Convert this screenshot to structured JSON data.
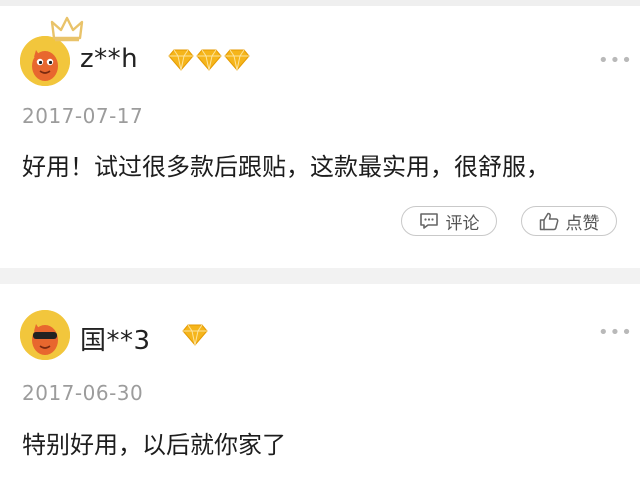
{
  "comments": [
    {
      "username": "z**h",
      "date": "2017-07-17",
      "text": "好用！试过很多款后跟贴，这款最实用，很舒服，",
      "diamond_count": 3,
      "more_label": "•••",
      "actions": {
        "comment_label": "评论",
        "like_label": "点赞"
      }
    },
    {
      "username": "国**3",
      "date": "2017-06-30",
      "text": "特别好用，以后就你家了",
      "diamond_count": 1,
      "more_label": "•••"
    }
  ],
  "colors": {
    "avatar_bg": "#f2c63c",
    "mascot_orange": "#e8672e",
    "diamond_gold": "#f5b51b",
    "crown_gold": "#e9c36a"
  },
  "icons": [
    "crown-icon",
    "diamond-icon",
    "more-icon",
    "comment-icon",
    "thumbs-up-icon"
  ]
}
